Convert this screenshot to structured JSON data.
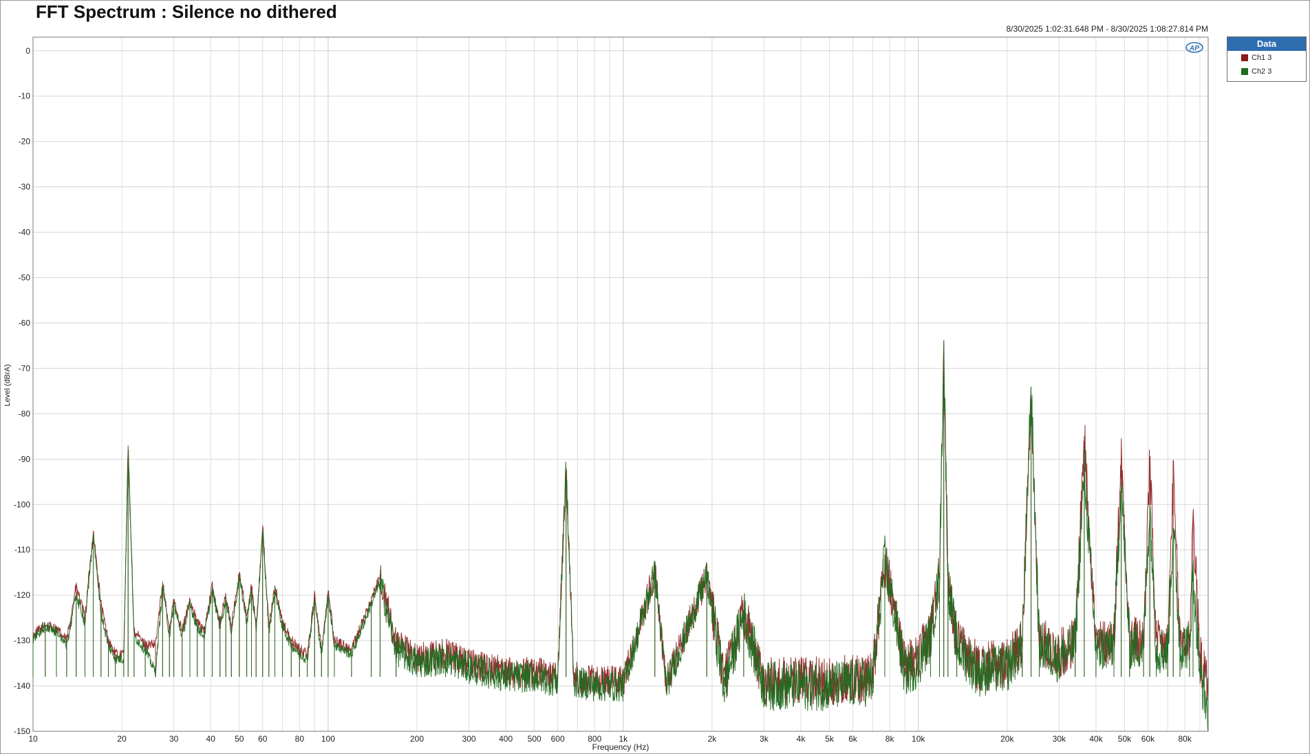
{
  "title": "FFT Spectrum : Silence no dithered",
  "date_range": "8/30/2025 1:02:31.648 PM - 8/30/2025 1:08:27.814 PM",
  "legend": {
    "header": "Data",
    "items": [
      {
        "label": "Ch1 3",
        "color": "#8b1a1a"
      },
      {
        "label": "Ch2 3",
        "color": "#1f6b1f"
      }
    ]
  },
  "logo_text": "AP",
  "chart_data": {
    "type": "line",
    "title": "FFT Spectrum : Silence no dithered",
    "xlabel": "Frequency (Hz)",
    "ylabel": "Level (dBrA)",
    "x_scale": "log",
    "xlim": [
      10,
      96000
    ],
    "ylim": [
      -150,
      3
    ],
    "grid": true,
    "x_ticks": [
      {
        "v": 10,
        "l": "10"
      },
      {
        "v": 20,
        "l": "20"
      },
      {
        "v": 30,
        "l": "30"
      },
      {
        "v": 40,
        "l": "40"
      },
      {
        "v": 50,
        "l": "50"
      },
      {
        "v": 60,
        "l": "60"
      },
      {
        "v": 80,
        "l": "80"
      },
      {
        "v": 100,
        "l": "100"
      },
      {
        "v": 200,
        "l": "200"
      },
      {
        "v": 300,
        "l": "300"
      },
      {
        "v": 400,
        "l": "400"
      },
      {
        "v": 500,
        "l": "500"
      },
      {
        "v": 600,
        "l": "600"
      },
      {
        "v": 800,
        "l": "800"
      },
      {
        "v": 1000,
        "l": "1k"
      },
      {
        "v": 2000,
        "l": "2k"
      },
      {
        "v": 3000,
        "l": "3k"
      },
      {
        "v": 4000,
        "l": "4k"
      },
      {
        "v": 5000,
        "l": "5k"
      },
      {
        "v": 6000,
        "l": "6k"
      },
      {
        "v": 8000,
        "l": "8k"
      },
      {
        "v": 10000,
        "l": "10k"
      },
      {
        "v": 20000,
        "l": "20k"
      },
      {
        "v": 30000,
        "l": "30k"
      },
      {
        "v": 40000,
        "l": "40k"
      },
      {
        "v": 50000,
        "l": "50k"
      },
      {
        "v": 60000,
        "l": "60k"
      },
      {
        "v": 80000,
        "l": "80k"
      }
    ],
    "y_ticks": [
      0,
      -10,
      -20,
      -30,
      -40,
      -50,
      -60,
      -70,
      -80,
      -90,
      -100,
      -110,
      -120,
      -130,
      -140,
      -150
    ],
    "series": [
      {
        "name": "Ch1 3",
        "color": "#8b1a1a",
        "points": [
          [
            10,
            -129
          ],
          [
            11,
            -126.5
          ],
          [
            12,
            -127.5
          ],
          [
            13,
            -130
          ],
          [
            14,
            -118
          ],
          [
            15,
            -125
          ],
          [
            16,
            -106
          ],
          [
            17,
            -122
          ],
          [
            18,
            -130
          ],
          [
            19,
            -133
          ],
          [
            20.3,
            -133
          ],
          [
            21,
            -87
          ],
          [
            22,
            -128
          ],
          [
            24,
            -131
          ],
          [
            26,
            -131
          ],
          [
            27.5,
            -117
          ],
          [
            29,
            -128
          ],
          [
            30,
            -121
          ],
          [
            32,
            -128
          ],
          [
            34,
            -121
          ],
          [
            36,
            -126
          ],
          [
            38,
            -128
          ],
          [
            40.5,
            -118
          ],
          [
            43,
            -126
          ],
          [
            45,
            -120
          ],
          [
            47,
            -127
          ],
          [
            50,
            -115
          ],
          [
            53,
            -125
          ],
          [
            55,
            -118
          ],
          [
            57,
            -127
          ],
          [
            60,
            -105
          ],
          [
            63,
            -127
          ],
          [
            66,
            -118
          ],
          [
            70,
            -126
          ],
          [
            75,
            -130
          ],
          [
            80,
            -132
          ],
          [
            85,
            -133
          ],
          [
            90,
            -120
          ],
          [
            95,
            -132
          ],
          [
            100,
            -119
          ],
          [
            105,
            -130
          ],
          [
            120,
            -132
          ],
          [
            140,
            -121
          ],
          [
            150,
            -116
          ],
          [
            170,
            -131
          ],
          [
            200,
            -134
          ],
          [
            250,
            -133
          ],
          [
            300,
            -135
          ],
          [
            400,
            -137
          ],
          [
            500,
            -137
          ],
          [
            600,
            -138
          ],
          [
            640,
            -92
          ],
          [
            680,
            -138
          ],
          [
            800,
            -139
          ],
          [
            1000,
            -139
          ],
          [
            1280,
            -115
          ],
          [
            1400,
            -139
          ],
          [
            1920,
            -116
          ],
          [
            2200,
            -139
          ],
          [
            2560,
            -124
          ],
          [
            3000,
            -139
          ],
          [
            4000,
            -139
          ],
          [
            5000,
            -139
          ],
          [
            7000,
            -138
          ],
          [
            7700,
            -112
          ],
          [
            9000,
            -136
          ],
          [
            10000,
            -134
          ],
          [
            11000,
            -128
          ],
          [
            11800,
            -115
          ],
          [
            12200,
            -64
          ],
          [
            12600,
            -116
          ],
          [
            13500,
            -130
          ],
          [
            16000,
            -136
          ],
          [
            20000,
            -135
          ],
          [
            22500,
            -130
          ],
          [
            24100,
            -78
          ],
          [
            25700,
            -130
          ],
          [
            30000,
            -133
          ],
          [
            34000,
            -130
          ],
          [
            36500,
            -85
          ],
          [
            40000,
            -131
          ],
          [
            46000,
            -130
          ],
          [
            48700,
            -89
          ],
          [
            52000,
            -130
          ],
          [
            58000,
            -130
          ],
          [
            60900,
            -90
          ],
          [
            64000,
            -131
          ],
          [
            70000,
            -131
          ],
          [
            73100,
            -94
          ],
          [
            77000,
            -130
          ],
          [
            83000,
            -130
          ],
          [
            85300,
            -102
          ],
          [
            90000,
            -134
          ],
          [
            96000,
            -140
          ]
        ]
      },
      {
        "name": "Ch2 3",
        "color": "#1f6b1f",
        "points": [
          [
            10,
            -129.5
          ],
          [
            11,
            -127
          ],
          [
            12,
            -128
          ],
          [
            13,
            -131
          ],
          [
            14,
            -120
          ],
          [
            15,
            -126
          ],
          [
            16,
            -107
          ],
          [
            17,
            -124
          ],
          [
            18,
            -131
          ],
          [
            19,
            -134
          ],
          [
            20.3,
            -134
          ],
          [
            21,
            -88
          ],
          [
            22,
            -129
          ],
          [
            24,
            -132
          ],
          [
            26,
            -137
          ],
          [
            27.5,
            -118
          ],
          [
            29,
            -129
          ],
          [
            30,
            -122
          ],
          [
            32,
            -129
          ],
          [
            34,
            -122
          ],
          [
            36,
            -127
          ],
          [
            38,
            -129
          ],
          [
            40.5,
            -119
          ],
          [
            43,
            -127
          ],
          [
            45,
            -121
          ],
          [
            47,
            -128
          ],
          [
            50,
            -116
          ],
          [
            53,
            -126
          ],
          [
            55,
            -119
          ],
          [
            57,
            -128
          ],
          [
            60,
            -106
          ],
          [
            63,
            -128
          ],
          [
            66,
            -119
          ],
          [
            70,
            -127
          ],
          [
            75,
            -131
          ],
          [
            80,
            -133
          ],
          [
            85,
            -134
          ],
          [
            90,
            -121
          ],
          [
            95,
            -133
          ],
          [
            100,
            -120
          ],
          [
            105,
            -131
          ],
          [
            120,
            -133
          ],
          [
            140,
            -122
          ],
          [
            150,
            -117
          ],
          [
            170,
            -132
          ],
          [
            200,
            -135
          ],
          [
            250,
            -134
          ],
          [
            300,
            -136
          ],
          [
            400,
            -138
          ],
          [
            500,
            -138
          ],
          [
            600,
            -139
          ],
          [
            640,
            -92
          ],
          [
            680,
            -139
          ],
          [
            800,
            -140
          ],
          [
            1000,
            -140
          ],
          [
            1280,
            -115
          ],
          [
            1400,
            -140
          ],
          [
            1920,
            -116
          ],
          [
            2200,
            -140
          ],
          [
            2560,
            -124
          ],
          [
            3000,
            -140
          ],
          [
            4000,
            -140
          ],
          [
            5000,
            -140
          ],
          [
            7000,
            -139
          ],
          [
            7700,
            -112
          ],
          [
            9000,
            -137
          ],
          [
            10000,
            -135
          ],
          [
            11000,
            -129
          ],
          [
            11800,
            -116
          ],
          [
            12200,
            -65
          ],
          [
            12600,
            -117
          ],
          [
            13500,
            -131
          ],
          [
            16000,
            -137
          ],
          [
            20000,
            -136
          ],
          [
            22500,
            -131
          ],
          [
            24100,
            -74
          ],
          [
            25700,
            -131
          ],
          [
            30000,
            -134
          ],
          [
            34000,
            -131
          ],
          [
            36500,
            -92
          ],
          [
            40000,
            -132
          ],
          [
            46000,
            -131
          ],
          [
            48700,
            -95
          ],
          [
            52000,
            -131
          ],
          [
            58000,
            -131
          ],
          [
            60900,
            -100
          ],
          [
            64000,
            -132
          ],
          [
            70000,
            -132
          ],
          [
            73100,
            -105
          ],
          [
            77000,
            -131
          ],
          [
            83000,
            -131
          ],
          [
            85300,
            -115
          ],
          [
            90000,
            -137
          ],
          [
            96000,
            -146
          ]
        ]
      }
    ]
  }
}
